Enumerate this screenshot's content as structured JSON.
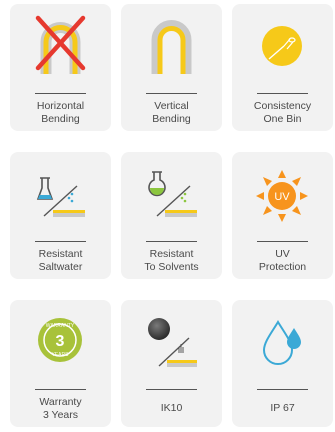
{
  "colors": {
    "card_bg": "#f2f2f2",
    "yellow": "#f6c919",
    "gray_strip": "#c9c9c9",
    "cross_red": "#e6392f",
    "text": "#4a4a4a",
    "water_blue": "#3ba9d6",
    "uv_orange": "#f7941d"
  },
  "features": [
    {
      "icon": "horizontal-bending-crossed-icon",
      "line1": "Horizontal",
      "line2": "Bending"
    },
    {
      "icon": "vertical-bending-icon",
      "line1": "Vertical",
      "line2": "Bending"
    },
    {
      "icon": "consistency-bin-icon",
      "line1": "Consistency",
      "line2": "One Bin"
    },
    {
      "icon": "saltwater-flask-icon",
      "line1": "Resistant",
      "line2": "Saltwater"
    },
    {
      "icon": "solvent-flask-icon",
      "line1": "Resistant",
      "line2": "To Solvents"
    },
    {
      "icon": "uv-sun-icon",
      "line1": "UV",
      "line2": "Protection"
    },
    {
      "icon": "warranty-seal-icon",
      "line1": "Warranty",
      "line2": "3 Years"
    },
    {
      "icon": "impact-ball-icon",
      "line1": "IK10",
      "line2": ""
    },
    {
      "icon": "water-drop-icon",
      "line1": "IP 67",
      "line2": ""
    }
  ]
}
